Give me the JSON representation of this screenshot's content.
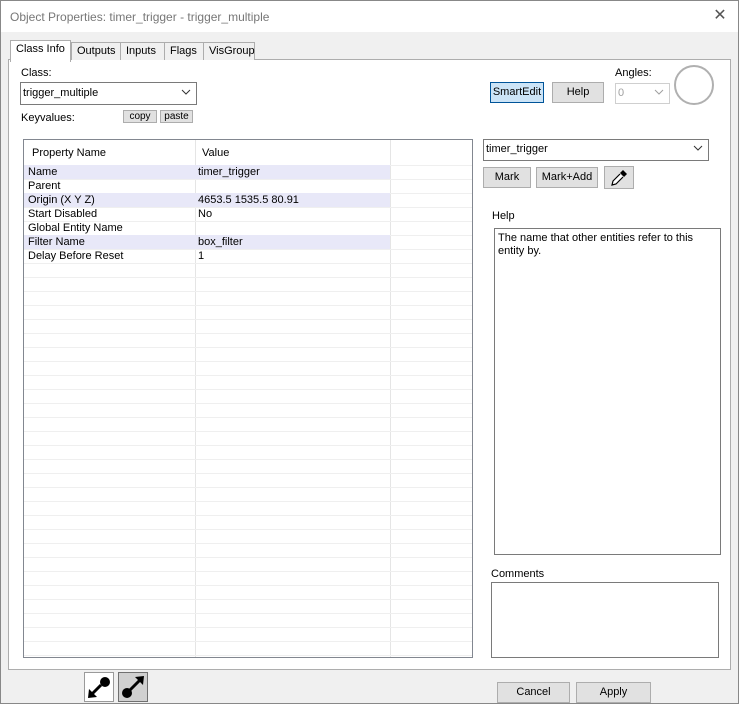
{
  "window": {
    "title": "Object Properties: timer_trigger - trigger_multiple",
    "close_glyph": "✕"
  },
  "tabs": [
    {
      "label": "Class Info"
    },
    {
      "label": "Outputs"
    },
    {
      "label": "Inputs"
    },
    {
      "label": "Flags"
    },
    {
      "label": "VisGroup"
    }
  ],
  "class_info": {
    "class_label": "Class:",
    "class_value": "trigger_multiple",
    "keyvalues_label": "Keyvalues:",
    "copy_label": "copy",
    "paste_label": "paste",
    "smartedit_label": "SmartEdit",
    "help_label": "Help",
    "angles_label": "Angles:",
    "angles_value": "0"
  },
  "grid": {
    "headers": [
      "Property Name",
      "Value"
    ],
    "rows": [
      {
        "name": "Name",
        "value": "timer_trigger"
      },
      {
        "name": "Parent",
        "value": ""
      },
      {
        "name": "Origin (X Y Z)",
        "value": "4653.5 1535.5 80.91"
      },
      {
        "name": "Start Disabled",
        "value": "No"
      },
      {
        "name": "Global Entity Name",
        "value": ""
      },
      {
        "name": "Filter Name",
        "value": "box_filter"
      },
      {
        "name": "Delay Before Reset",
        "value": "1"
      }
    ]
  },
  "right_panel": {
    "value_combo": "timer_trigger",
    "mark_label": "Mark",
    "markadd_label": "Mark+Add",
    "help_header": "Help",
    "help_text": "The name that other entities refer to this entity by.",
    "comments_header": "Comments"
  },
  "footer": {
    "cancel_label": "Cancel",
    "apply_label": "Apply"
  },
  "icons": {
    "eyedropper": "eyedropper-icon",
    "pick_entity": "pick-entity-arrow-icon",
    "goto_entity": "goto-entity-arrow-icon",
    "dropdown": "chevron-down-icon"
  }
}
